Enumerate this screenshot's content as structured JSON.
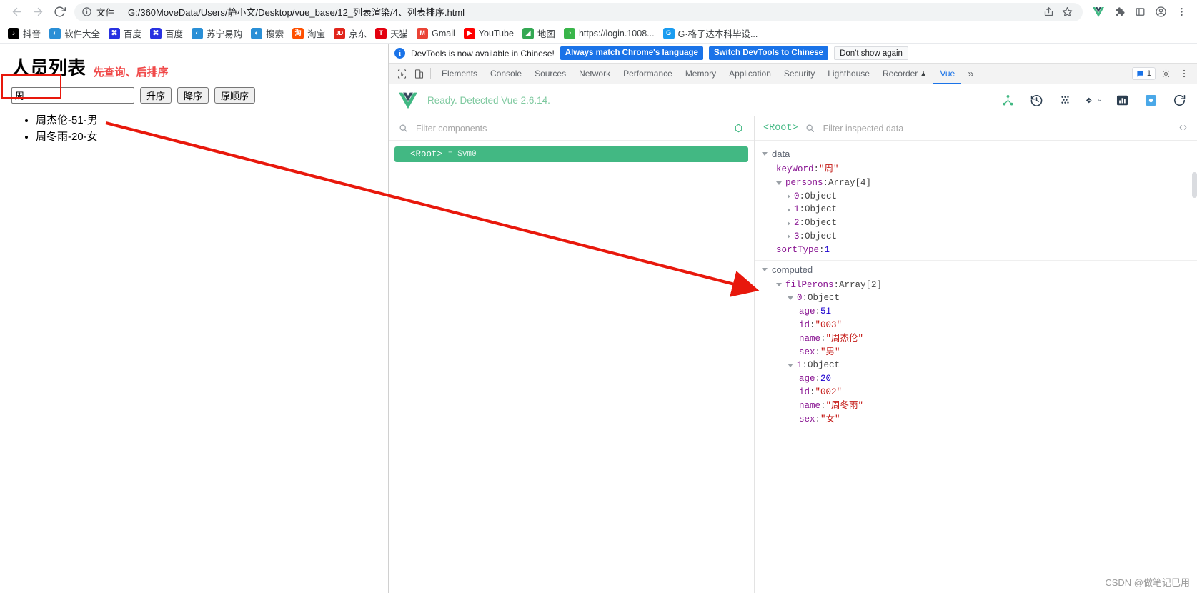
{
  "browser": {
    "nav": {
      "back_icon": "arrow-left-icon",
      "forward_icon": "arrow-right-icon",
      "reload_icon": "reload-icon"
    },
    "omnibox": {
      "info_icon": "info-circle-icon",
      "scheme_label": "文件",
      "url": "G:/360MoveData/Users/静小文/Desktop/vue_base/12_列表渲染/4、列表排序.html",
      "share_icon": "share-icon",
      "bookmark_icon": "star-icon"
    },
    "toolbar_right": [
      {
        "name": "extension-vue-icon",
        "glyph": "V",
        "color": "#41b883"
      },
      {
        "name": "extension-puzzle-icon",
        "glyph": "✵",
        "color": "#5f6368"
      },
      {
        "name": "extension-window-icon",
        "glyph": "▢",
        "color": "#5f6368"
      },
      {
        "name": "profile-avatar-icon",
        "glyph": "●",
        "color": "#5f6368"
      },
      {
        "name": "chrome-menu-icon",
        "glyph": "⋮",
        "color": "#5f6368"
      }
    ],
    "bookmarks": [
      {
        "label": "抖音",
        "icon_glyph": "♪",
        "icon_color": "#000000"
      },
      {
        "label": "软件大全",
        "icon_glyph": "◐",
        "icon_color": "#2a8fd6"
      },
      {
        "label": "百度",
        "icon_glyph": "⌘",
        "icon_color": "#2932e1"
      },
      {
        "label": "百度",
        "icon_glyph": "⌘",
        "icon_color": "#2932e1"
      },
      {
        "label": "苏宁易购",
        "icon_glyph": "◐",
        "icon_color": "#2a8fd6"
      },
      {
        "label": "搜索",
        "icon_glyph": "◐",
        "icon_color": "#2a8fd6"
      },
      {
        "label": "淘宝",
        "icon_glyph": "淘",
        "icon_color": "#ff5000"
      },
      {
        "label": "京东",
        "icon_glyph": "JD",
        "icon_color": "#e1251b"
      },
      {
        "label": "天猫",
        "icon_glyph": "T",
        "icon_color": "#e3000f"
      },
      {
        "label": "Gmail",
        "icon_glyph": "M",
        "icon_color": "#ea4335"
      },
      {
        "label": "YouTube",
        "icon_glyph": "▶",
        "icon_color": "#ff0000"
      },
      {
        "label": "地图",
        "icon_glyph": "◢",
        "icon_color": "#34a853"
      },
      {
        "label": "https://login.1008...",
        "icon_glyph": "◔",
        "icon_color": "#39b54a"
      },
      {
        "label": "G·格子达本科毕设...",
        "icon_glyph": "G",
        "icon_color": "#1a9cf0"
      }
    ]
  },
  "page": {
    "title": "人员列表",
    "note": "先查询、后排序",
    "search": {
      "value": "周",
      "placeholder": ""
    },
    "buttons": {
      "asc": "升序",
      "desc": "降序",
      "original": "原顺序"
    },
    "list": [
      "周杰伦-51-男",
      "周冬雨-20-女"
    ]
  },
  "devtools": {
    "banner": {
      "info_icon": "info-circle-icon",
      "message": "DevTools is now available in Chinese!",
      "btn_always": "Always match Chrome's language",
      "btn_switch": "Switch DevTools to Chinese",
      "btn_dismiss": "Don't show again"
    },
    "tools": {
      "inspect_icon": "inspect-cursor-icon",
      "device_icon": "device-toolbar-icon"
    },
    "tabs": [
      {
        "label": "Elements",
        "active": false
      },
      {
        "label": "Console",
        "active": false
      },
      {
        "label": "Sources",
        "active": false
      },
      {
        "label": "Network",
        "active": false
      },
      {
        "label": "Performance",
        "active": false
      },
      {
        "label": "Memory",
        "active": false
      },
      {
        "label": "Application",
        "active": false
      },
      {
        "label": "Security",
        "active": false
      },
      {
        "label": "Lighthouse",
        "active": false
      },
      {
        "label": "Recorder",
        "active": false,
        "suffix_icon": "flask-icon"
      },
      {
        "label": "Vue",
        "active": true
      }
    ],
    "overflow_label": "»",
    "message_badge": {
      "icon": "message-icon",
      "count": "1"
    },
    "settings_icon": "gear-icon",
    "kebab_icon": "kebab-menu-icon"
  },
  "vue": {
    "logo_icon": "vue-logo-icon",
    "status": "Ready. Detected Vue 2.6.14.",
    "actions": [
      {
        "name": "component-tree-icon",
        "glyph": "tree"
      },
      {
        "name": "timeline-history-icon",
        "glyph": "history"
      },
      {
        "name": "vuex-icon",
        "glyph": "vuex"
      },
      {
        "name": "routes-icon",
        "glyph": "router"
      },
      {
        "name": "performance-icon",
        "glyph": "chart"
      },
      {
        "name": "settings-icon",
        "glyph": "gear"
      },
      {
        "name": "refresh-icon",
        "glyph": "refresh"
      }
    ],
    "components_panel": {
      "search_icon": "search-icon",
      "filter_placeholder": "Filter components",
      "refresh_icon": "target-refresh-icon",
      "root_node": "<Root>",
      "root_vm": "= $vm0"
    },
    "inspector": {
      "root_label": "<Root>",
      "search_icon": "search-icon",
      "filter_placeholder": "Filter inspected data",
      "code_icon": "code-brackets-icon",
      "groups": [
        {
          "name": "data",
          "open": true,
          "entries": [
            {
              "depth": 1,
              "arrow": "none",
              "key": "keyWord",
              "value": "\"周\"",
              "type": "string"
            },
            {
              "depth": 1,
              "arrow": "open",
              "key": "persons",
              "value": "Array[4]",
              "type": "plain"
            },
            {
              "depth": 2,
              "arrow": "closed",
              "key": "0",
              "value": "Object",
              "type": "plain"
            },
            {
              "depth": 2,
              "arrow": "closed",
              "key": "1",
              "value": "Object",
              "type": "plain"
            },
            {
              "depth": 2,
              "arrow": "closed",
              "key": "2",
              "value": "Object",
              "type": "plain"
            },
            {
              "depth": 2,
              "arrow": "closed",
              "key": "3",
              "value": "Object",
              "type": "plain"
            },
            {
              "depth": 1,
              "arrow": "none",
              "key": "sortType",
              "value": "1",
              "type": "number"
            }
          ]
        },
        {
          "name": "computed",
          "open": true,
          "entries": [
            {
              "depth": 1,
              "arrow": "open",
              "key": "filPerons",
              "value": "Array[2]",
              "type": "plain"
            },
            {
              "depth": 2,
              "arrow": "open",
              "key": "0",
              "value": "Object",
              "type": "plain"
            },
            {
              "depth": 3,
              "arrow": "none",
              "key": "age",
              "value": "51",
              "type": "number"
            },
            {
              "depth": 3,
              "arrow": "none",
              "key": "id",
              "value": "\"003\"",
              "type": "string"
            },
            {
              "depth": 3,
              "arrow": "none",
              "key": "name",
              "value": "\"周杰伦\"",
              "type": "string"
            },
            {
              "depth": 3,
              "arrow": "none",
              "key": "sex",
              "value": "\"男\"",
              "type": "string"
            },
            {
              "depth": 2,
              "arrow": "open",
              "key": "1",
              "value": "Object",
              "type": "plain"
            },
            {
              "depth": 3,
              "arrow": "none",
              "key": "age",
              "value": "20",
              "type": "number"
            },
            {
              "depth": 3,
              "arrow": "none",
              "key": "id",
              "value": "\"002\"",
              "type": "string"
            },
            {
              "depth": 3,
              "arrow": "none",
              "key": "name",
              "value": "\"周冬雨\"",
              "type": "string"
            },
            {
              "depth": 3,
              "arrow": "none",
              "key": "sex",
              "value": "\"女\"",
              "type": "string"
            }
          ]
        }
      ]
    }
  },
  "annotations": {
    "arrow_color": "#e8180c",
    "highlight_color": "#e8180c"
  },
  "watermark": "CSDN @做笔记巳用"
}
